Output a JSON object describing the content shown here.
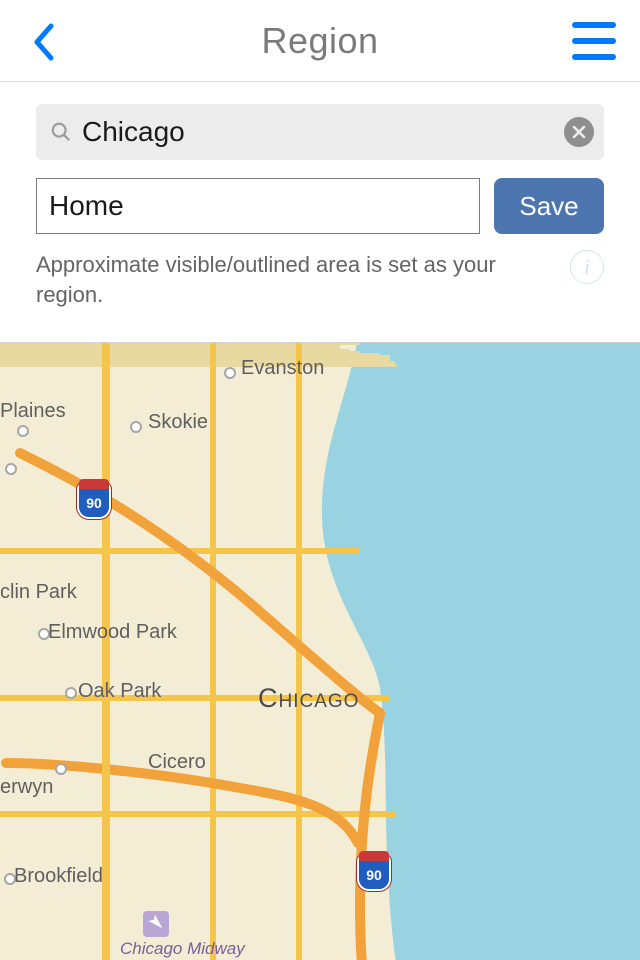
{
  "header": {
    "title": "Region",
    "back_icon": "chevron-left",
    "menu_icon": "menu"
  },
  "search": {
    "value": "Chicago",
    "placeholder": "Search"
  },
  "region_name": {
    "value": "Home",
    "placeholder": "Name"
  },
  "save_label": "Save",
  "description": "Approximate visible/outlined area is set as your region.",
  "info_icon": "info",
  "map": {
    "focus_city": "Chicago",
    "highway_shields": [
      "90",
      "90"
    ],
    "places": [
      "Evanston",
      "Plaines",
      "Skokie",
      "clin Park",
      "Elmwood Park",
      "Oak Park",
      "Cicero",
      "erwyn",
      "Brookfield",
      "Chicago Midway"
    ],
    "airport": "Chicago Midway"
  }
}
